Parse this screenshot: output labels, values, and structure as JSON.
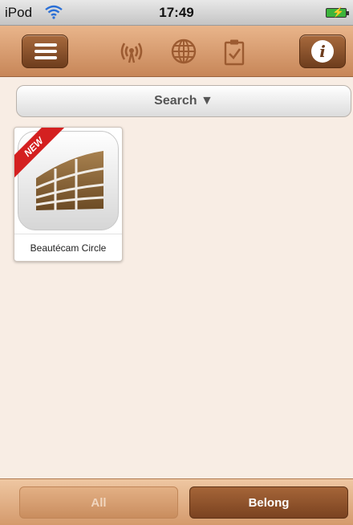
{
  "status_bar": {
    "carrier": "iPod",
    "time": "17:49"
  },
  "toolbar": {
    "icons": [
      "menu-icon",
      "broadcast-icon",
      "globe-icon",
      "clipboard-check-icon",
      "info-icon"
    ],
    "info_glyph": "i"
  },
  "search": {
    "label": "Search ▼"
  },
  "apps": [
    {
      "name": "Beautécam Circle",
      "badge": "NEW"
    }
  ],
  "bottom_bar": {
    "all_label": "All",
    "belong_label": "Belong",
    "selected": "Belong"
  },
  "colors": {
    "accent": "#7a4220",
    "toolbar": "#c78658",
    "background": "#f8ede4",
    "badge": "#d42020"
  }
}
